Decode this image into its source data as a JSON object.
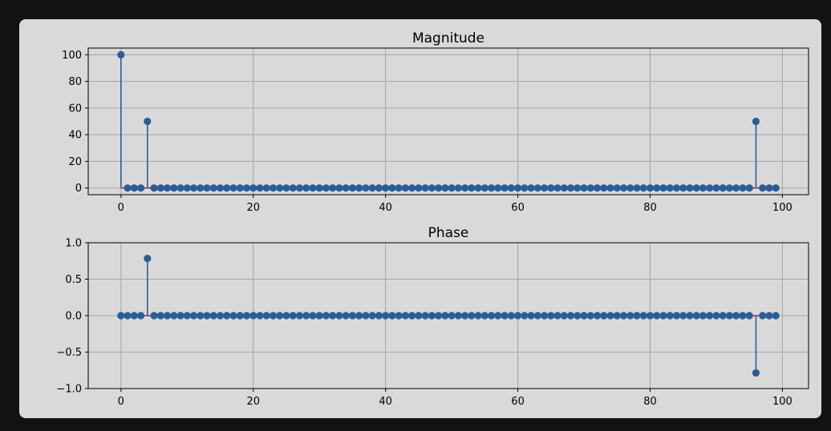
{
  "chart_data": [
    {
      "type": "stem",
      "title": "Magnitude",
      "xlabel": "",
      "ylabel": "",
      "xlim": [
        -4.95,
        103.95
      ],
      "ylim": [
        -5,
        105
      ],
      "xticks": [
        0,
        20,
        40,
        60,
        80,
        100
      ],
      "yticks": [
        0,
        20,
        40,
        60,
        80,
        100
      ],
      "xtick_labels": [
        "0",
        "20",
        "40",
        "60",
        "80",
        "100"
      ],
      "ytick_labels": [
        "0",
        "20",
        "40",
        "60",
        "80",
        "100"
      ],
      "grid": true,
      "x_range": [
        0,
        99
      ],
      "default_value": 0,
      "points": [
        {
          "x": 0,
          "y": 100
        },
        {
          "x": 4,
          "y": 50
        },
        {
          "x": 96,
          "y": 50
        }
      ]
    },
    {
      "type": "stem",
      "title": "Phase",
      "xlabel": "",
      "ylabel": "",
      "xlim": [
        -4.95,
        103.95
      ],
      "ylim": [
        -1.0,
        1.0
      ],
      "xticks": [
        0,
        20,
        40,
        60,
        80,
        100
      ],
      "yticks": [
        -1.0,
        -0.5,
        0.0,
        0.5,
        1.0
      ],
      "xtick_labels": [
        "0",
        "20",
        "40",
        "60",
        "80",
        "100"
      ],
      "ytick_labels": [
        "−1.0",
        "−0.5",
        "0.0",
        "0.5",
        "1.0"
      ],
      "grid": true,
      "x_range": [
        0,
        99
      ],
      "default_value": 0,
      "points": [
        {
          "x": 4,
          "y": 0.785
        },
        {
          "x": 96,
          "y": -0.785
        }
      ]
    }
  ],
  "colors": {
    "page_background": "#121212",
    "figure_background": "#d9d9d9",
    "stem": "#2a5d96",
    "marker": "#2a5d96",
    "baseline": "#b22222",
    "grid": "#a6a6a6",
    "axes": "#000000"
  }
}
